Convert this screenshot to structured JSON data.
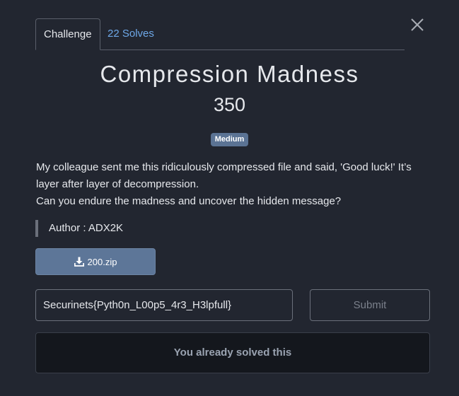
{
  "tabs": [
    {
      "label": "Challenge",
      "active": true
    },
    {
      "label": "22 Solves",
      "active": false
    }
  ],
  "challenge": {
    "title": "Compression Madness",
    "points": "350",
    "difficulty": "Medium",
    "description": [
      "My colleague sent me this ridiculously compressed file and said, 'Good luck!' It’s layer after layer of decompression.",
      "Can you endure the madness and uncover the hidden message?"
    ],
    "author": "Author : ADX2K",
    "file": {
      "name": "200.zip",
      "icon": "download-icon"
    }
  },
  "form": {
    "flag_value": "Securinets{Pyth0n_L00p5_4r3_H3lpfull}",
    "submit_label": "Submit"
  },
  "status": {
    "message": "You already solved this"
  },
  "icons": {
    "close": "close-icon",
    "download": "download-icon"
  },
  "colors": {
    "background": "#222630",
    "accent_link": "#6ea8e8",
    "badge": "#5b7394",
    "file_button": "#5d7698",
    "solved_box": "#14171d"
  }
}
